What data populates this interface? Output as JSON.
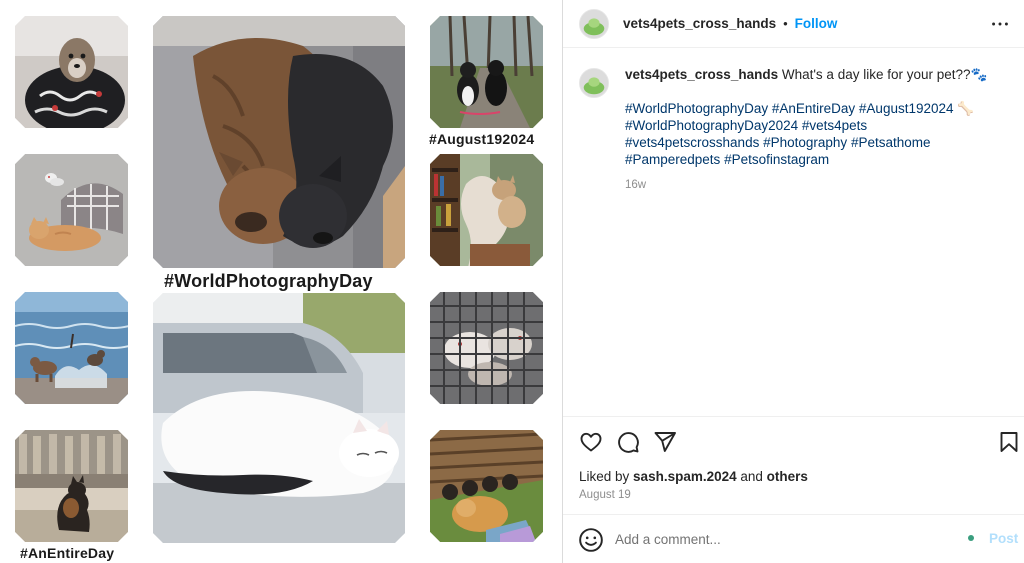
{
  "collage": {
    "captions": {
      "august": "#August192024",
      "world": "#WorldPhotographyDay",
      "entire": "#AnEntireDay"
    }
  },
  "header": {
    "username": "vets4pets_cross_hands",
    "separator": "•",
    "follow_label": "Follow",
    "more_icon": "more-horizontal-icon"
  },
  "caption": {
    "username": "vets4pets_cross_hands",
    "text": " What's a day like for your pet??🐾",
    "hashtags": [
      "#WorldPhotographyDay",
      "#AnEntireDay",
      "#August192024",
      "🦴",
      "#WorldPhotographyDay2024",
      "#vets4pets",
      "#vets4petscrosshands",
      "#Photography",
      "#Petsathome",
      "#Pamperedpets",
      "#Petsofinstagram"
    ],
    "age": "16w"
  },
  "actions": {
    "like_icon": "heart-icon",
    "comment_icon": "comment-icon",
    "share_icon": "share-icon",
    "save_icon": "bookmark-icon",
    "liked_by_prefix": "Liked by ",
    "liked_by_user": "sash.spam.2024",
    "liked_by_and": " and ",
    "liked_by_others": "others",
    "date": "August 19"
  },
  "comment": {
    "placeholder": "Add a comment...",
    "post_label": "Post",
    "emoji_icon": "smiley-icon"
  },
  "colors": {
    "link": "#00376b",
    "follow": "#0095f6",
    "post_disabled": "#b2dffc",
    "muted": "#8e8e8e"
  }
}
